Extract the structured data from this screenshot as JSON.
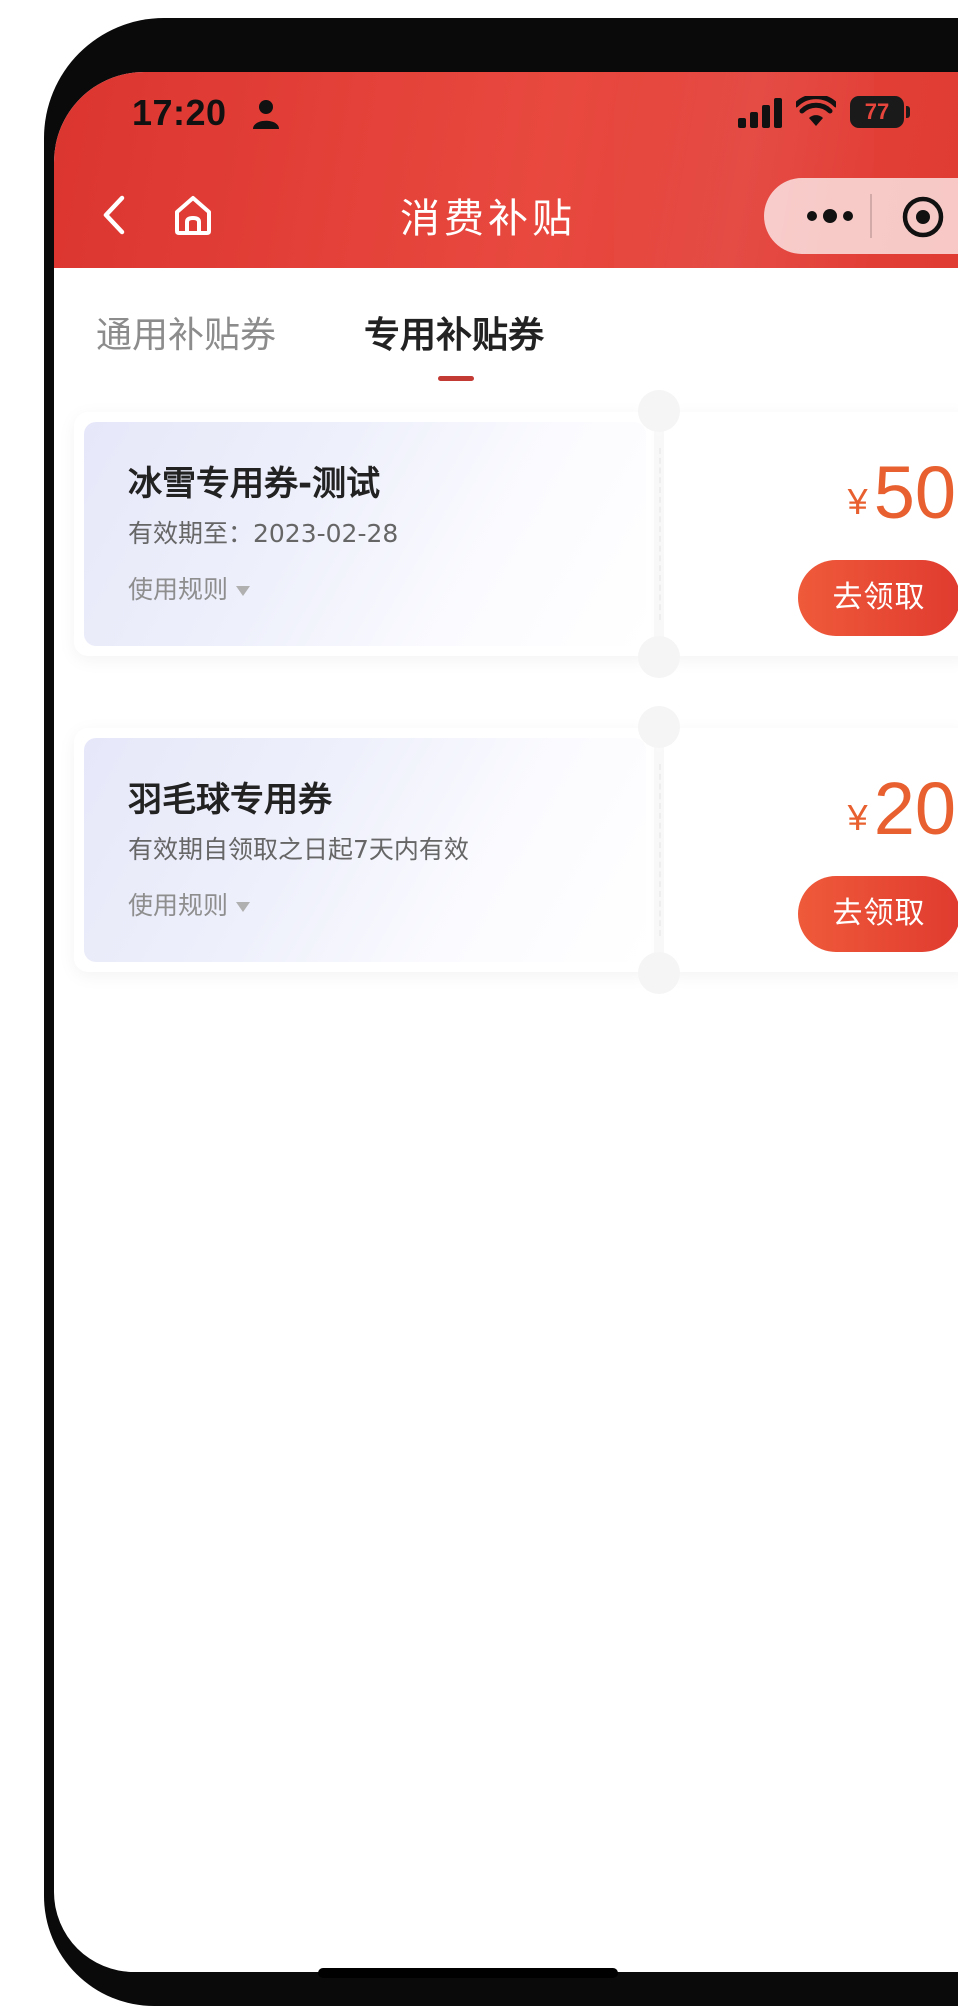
{
  "status_bar": {
    "time": "17:20",
    "battery": "77",
    "icons": [
      "person-icon",
      "signal-icon",
      "wifi-icon",
      "battery-icon"
    ]
  },
  "nav": {
    "title": "消费补贴",
    "icons": [
      "back-icon",
      "home-icon",
      "more-icon",
      "target-icon"
    ]
  },
  "tabs": [
    {
      "label": "通用补贴券",
      "active": false
    },
    {
      "label": "专用补贴券",
      "active": true
    }
  ],
  "coupons": [
    {
      "title": "冰雪专用券-测试",
      "validity": "有效期至：2023-02-28",
      "rules": "使用规则",
      "currency": "¥",
      "amount": "50",
      "button": "去领取"
    },
    {
      "title": "羽毛球专用券",
      "validity": "有效期自领取之日起7天内有效",
      "rules": "使用规则",
      "currency": "¥",
      "amount": "20",
      "button": "去领取"
    }
  ],
  "colors": {
    "header_red": "#e0403a",
    "accent_orange": "#e8602f",
    "tab_indicator": "#c33a34",
    "button_red": "#e03b2f",
    "coupon_tint": "#e6e8fa"
  }
}
